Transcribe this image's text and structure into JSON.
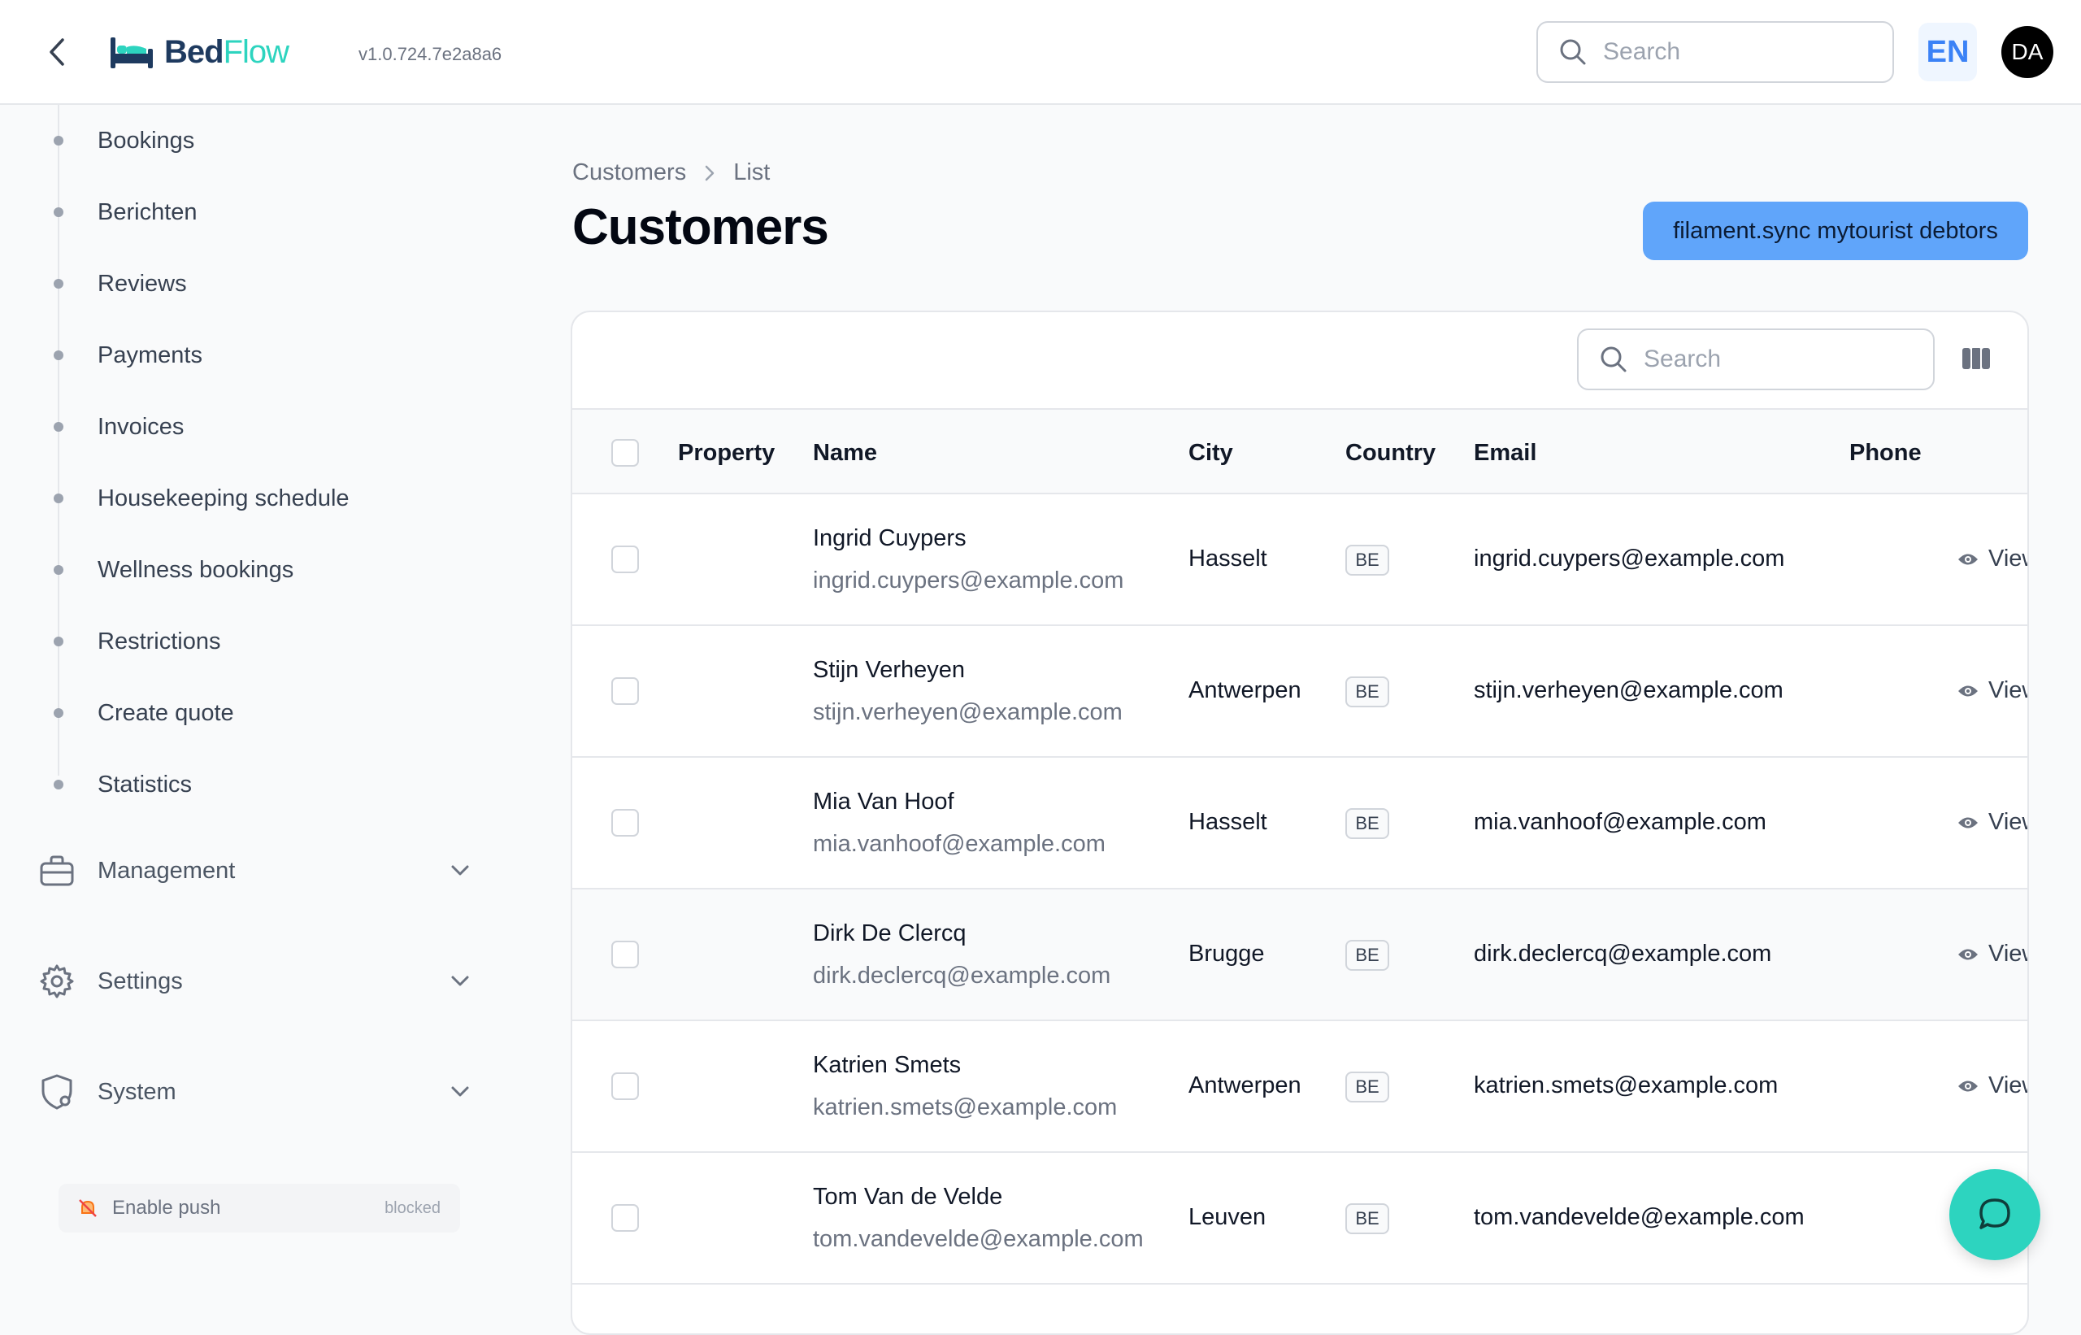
{
  "header": {
    "logo_part1": "Bed",
    "logo_part2": "Flow",
    "version": "v1.0.724.7e2a8a6",
    "search_placeholder": "Search",
    "language": "EN",
    "avatar_initials": "DA"
  },
  "sidebar": {
    "items": [
      {
        "label": "Bookings"
      },
      {
        "label": "Berichten"
      },
      {
        "label": "Reviews"
      },
      {
        "label": "Payments"
      },
      {
        "label": "Invoices"
      },
      {
        "label": "Housekeeping schedule"
      },
      {
        "label": "Wellness bookings"
      },
      {
        "label": "Restrictions"
      },
      {
        "label": "Create quote"
      },
      {
        "label": "Statistics"
      }
    ],
    "groups": [
      {
        "label": "Management",
        "icon": "briefcase-icon"
      },
      {
        "label": "Settings",
        "icon": "gear-icon"
      },
      {
        "label": "System",
        "icon": "shield-gear-icon"
      }
    ],
    "push": {
      "label": "Enable push",
      "status": "blocked"
    }
  },
  "main": {
    "breadcrumb": [
      "Customers",
      "List"
    ],
    "title": "Customers",
    "sync_button": "filament.sync mytourist debtors",
    "table": {
      "search_placeholder": "Search",
      "columns": [
        "Property",
        "Name",
        "City",
        "Country",
        "Email",
        "Phone"
      ],
      "view_label": "View",
      "rows": [
        {
          "name": "Ingrid Cuypers",
          "sub": "ingrid.cuypers@example.com",
          "city": "Hasselt",
          "country": "BE",
          "email": "ingrid.cuypers@example.com"
        },
        {
          "name": "Stijn Verheyen",
          "sub": "stijn.verheyen@example.com",
          "city": "Antwerpen",
          "country": "BE",
          "email": "stijn.verheyen@example.com"
        },
        {
          "name": "Mia Van Hoof",
          "sub": "mia.vanhoof@example.com",
          "city": "Hasselt",
          "country": "BE",
          "email": "mia.vanhoof@example.com"
        },
        {
          "name": "Dirk De Clercq",
          "sub": "dirk.declercq@example.com",
          "city": "Brugge",
          "country": "BE",
          "email": "dirk.declercq@example.com"
        },
        {
          "name": "Katrien Smets",
          "sub": "katrien.smets@example.com",
          "city": "Antwerpen",
          "country": "BE",
          "email": "katrien.smets@example.com"
        },
        {
          "name": "Tom Van de Velde",
          "sub": "tom.vandevelde@example.com",
          "city": "Leuven",
          "country": "BE",
          "email": "tom.vandevelde@example.com"
        }
      ]
    }
  },
  "colors": {
    "accent": "#60a5fa",
    "brand_teal": "#2dd4bf",
    "brand_navy": "#1e3a5f"
  }
}
